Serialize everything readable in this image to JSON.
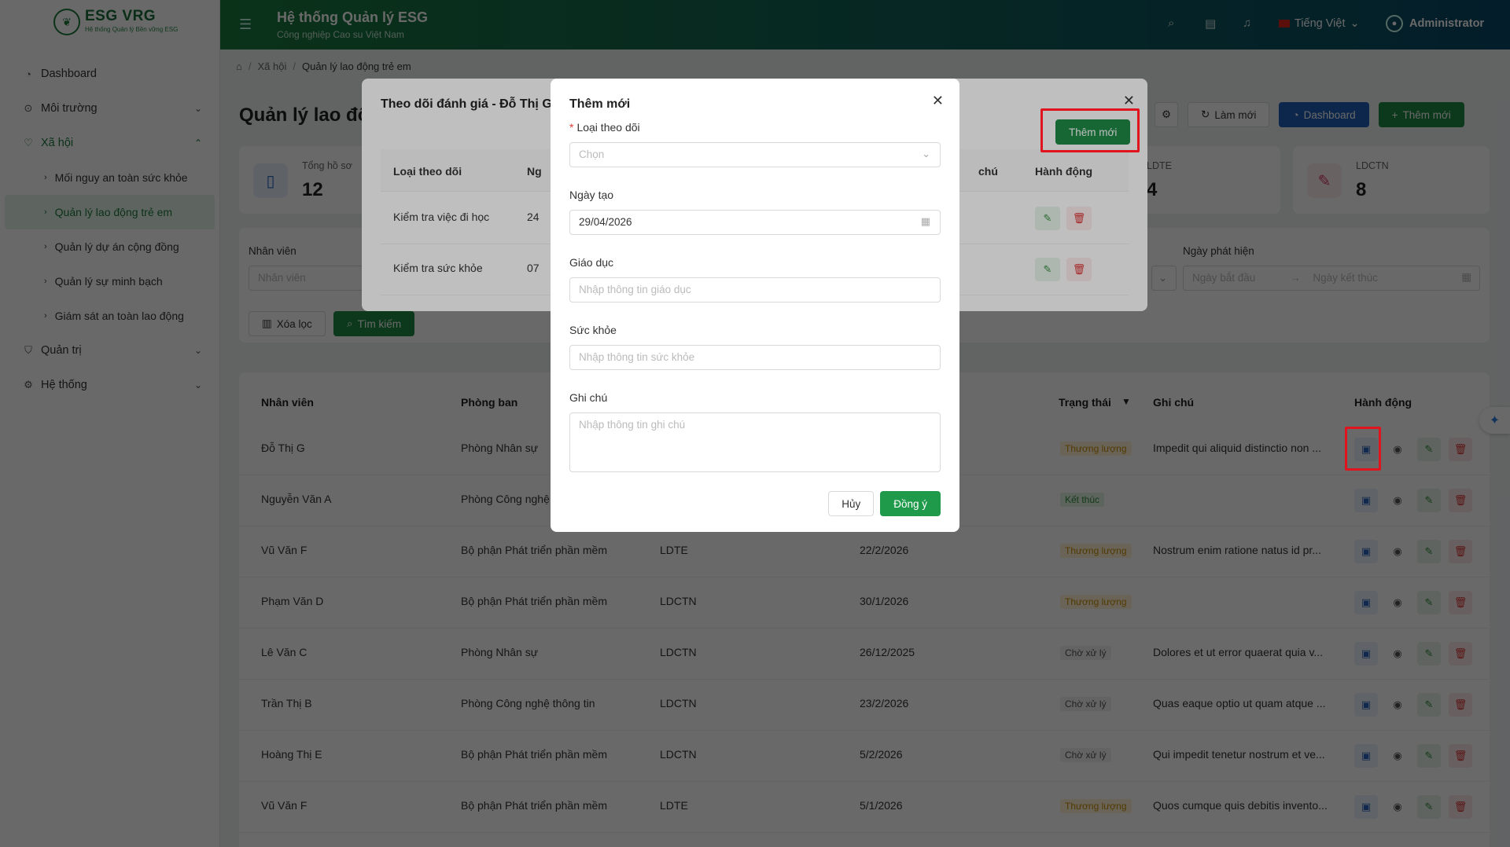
{
  "app": {
    "logo_title": "ESG VRG",
    "logo_subtitle": "Hệ thống Quản lý Bền vững ESG",
    "header_title": "Hệ thống Quản lý ESG",
    "header_subtitle": "Công nghiệp Cao su Việt Nam",
    "language": "Tiếng Việt",
    "user": "Administrator"
  },
  "sidebar": {
    "items": [
      {
        "label": "Dashboard",
        "icon": "dashboard-icon"
      },
      {
        "label": "Môi trường",
        "icon": "location-icon"
      },
      {
        "label": "Xã hội",
        "icon": "heart-icon"
      },
      {
        "label": "Quản trị",
        "icon": "shield-icon"
      },
      {
        "label": "Hệ thống",
        "icon": "gear-icon"
      }
    ],
    "sub_items": [
      {
        "label": "Mối nguy an toàn sức khỏe"
      },
      {
        "label": "Quản lý lao động trẻ em"
      },
      {
        "label": "Quản lý dự án cộng đồng"
      },
      {
        "label": "Quản lý sự minh bạch"
      },
      {
        "label": "Giám sát an toàn lao động"
      }
    ]
  },
  "breadcrumb": [
    "Xã hội",
    "Quản lý lao động trẻ em"
  ],
  "page": {
    "title": "Quản lý lao động trẻ em",
    "refresh_label": "Làm mới",
    "dashboard_label": "Dashboard",
    "add_label": "Thêm mới"
  },
  "stats": [
    {
      "label": "Tổng hồ sơ",
      "value": "12"
    },
    {
      "label": "LDTE",
      "value": "4"
    },
    {
      "label": "LDCTN",
      "value": "8"
    }
  ],
  "filters": {
    "employee_label": "Nhân viên",
    "employee_placeholder": "Nhân viên",
    "date_label": "Ngày phát hiện",
    "start_placeholder": "Ngày bắt đầu",
    "end_placeholder": "Ngày kết thúc",
    "clear_label": "Xóa lọc",
    "search_label": "Tìm kiếm"
  },
  "table": {
    "headers": {
      "employee": "Nhân viên",
      "department": "Phòng ban",
      "status": "Trạng thái",
      "note": "Ghi chú",
      "actions": "Hành động"
    },
    "rows": [
      {
        "employee": "Đỗ Thị G",
        "department": "Phòng Nhân sự",
        "type": "",
        "date": "",
        "status": "Thương lượng",
        "status_kind": "warn",
        "note": "Impedit qui aliquid distinctio non ..."
      },
      {
        "employee": "Nguyễn Văn A",
        "department": "Phòng Công nghệ",
        "type": "",
        "date": "",
        "status": "Kết thúc",
        "status_kind": "done",
        "note": ""
      },
      {
        "employee": "Vũ Văn F",
        "department": "Bộ phận Phát triển phần mềm",
        "type": "LDTE",
        "date": "22/2/2026",
        "status": "Thương lượng",
        "status_kind": "warn",
        "note": "Nostrum enim ratione natus id pr..."
      },
      {
        "employee": "Phạm Văn D",
        "department": "Bộ phận Phát triển phần mềm",
        "type": "LDCTN",
        "date": "30/1/2026",
        "status": "Thương lượng",
        "status_kind": "warn",
        "note": ""
      },
      {
        "employee": "Lê Văn C",
        "department": "Phòng Nhân sự",
        "type": "LDCTN",
        "date": "26/12/2025",
        "status": "Chờ xử lý",
        "status_kind": "pend",
        "note": "Dolores et ut error quaerat quia v..."
      },
      {
        "employee": "Trần Thị B",
        "department": "Phòng Công nghệ thông tin",
        "type": "LDCTN",
        "date": "23/2/2026",
        "status": "Chờ xử lý",
        "status_kind": "pend",
        "note": "Quas eaque optio ut quam atque ..."
      },
      {
        "employee": "Hoàng Thị E",
        "department": "Bộ phận Phát triển phần mềm",
        "type": "LDCTN",
        "date": "5/2/2026",
        "status": "Chờ xử lý",
        "status_kind": "pend",
        "note": "Qui impedit tenetur nostrum et ve..."
      },
      {
        "employee": "Vũ Văn F",
        "department": "Bộ phận Phát triển phần mềm",
        "type": "LDTE",
        "date": "5/1/2026",
        "status": "Thương lượng",
        "status_kind": "warn",
        "note": "Quos cumque quis debitis invento..."
      }
    ]
  },
  "tracking_modal": {
    "title": "Theo dõi đánh giá - Đỗ Thị G",
    "add_label": "Thêm mới",
    "headers": {
      "type": "Loại theo dõi",
      "date_partial": "Ng",
      "note_partial": "chú",
      "actions": "Hành động"
    },
    "rows": [
      {
        "type": "Kiểm tra việc đi học",
        "date_partial": "24"
      },
      {
        "type": "Kiểm tra sức khỏe",
        "date_partial": "07"
      }
    ]
  },
  "add_modal": {
    "title": "Thêm mới",
    "type_label": "Loại theo dõi",
    "type_placeholder": "Chọn",
    "date_label": "Ngày tạo",
    "date_value": "29/04/2026",
    "education_label": "Giáo dục",
    "education_placeholder": "Nhập thông tin giáo dục",
    "health_label": "Sức khỏe",
    "health_placeholder": "Nhập thông tin sức khỏe",
    "note_label": "Ghi chú",
    "note_placeholder": "Nhập thông tin ghi chú",
    "cancel_label": "Hủy",
    "ok_label": "Đồng ý"
  },
  "colors": {
    "brand": "#1e8a46",
    "header_gradient_end": "#0a4a66",
    "highlight": "#e0141e"
  }
}
